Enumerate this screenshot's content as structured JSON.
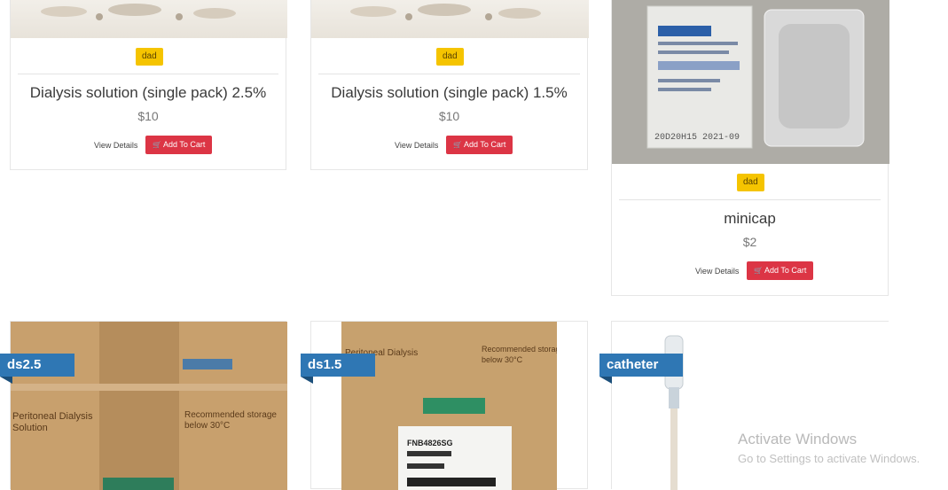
{
  "products_top": [
    {
      "badge": "dad",
      "title": "Dialysis solution (single pack) 2.5%",
      "price": "$10",
      "view": "View Details",
      "cart": "Add To Cart"
    },
    {
      "badge": "dad",
      "title": "Dialysis solution (single pack) 1.5%",
      "price": "$10",
      "view": "View Details",
      "cart": "Add To Cart"
    },
    {
      "badge": "dad",
      "title": "minicap",
      "price": "$2",
      "view": "View Details",
      "cart": "Add To Cart",
      "image_text": {
        "date": "20D20H15 2021-09",
        "brand": "MiniCap"
      }
    }
  ],
  "products_bottom": [
    {
      "ribbon": "ds2.5",
      "box_text": {
        "left1": "Peritoneal Dialysis",
        "left2": "Solution",
        "right1": "Recommended storage",
        "right2": "below 30°C"
      }
    },
    {
      "ribbon": "ds1.5",
      "box_text": {
        "left1": "Peritoneal Dialysis",
        "right1": "Recommended storage",
        "right2": "below 30°C",
        "label": "FNB4826SG"
      }
    },
    {
      "ribbon": "catheter"
    }
  ],
  "watermark": {
    "title": "Activate Windows",
    "subtitle": "Go to Settings to activate Windows."
  },
  "colors": {
    "badge": "#f5c400",
    "cart": "#dc3545",
    "ribbon": "#2f77b4"
  }
}
